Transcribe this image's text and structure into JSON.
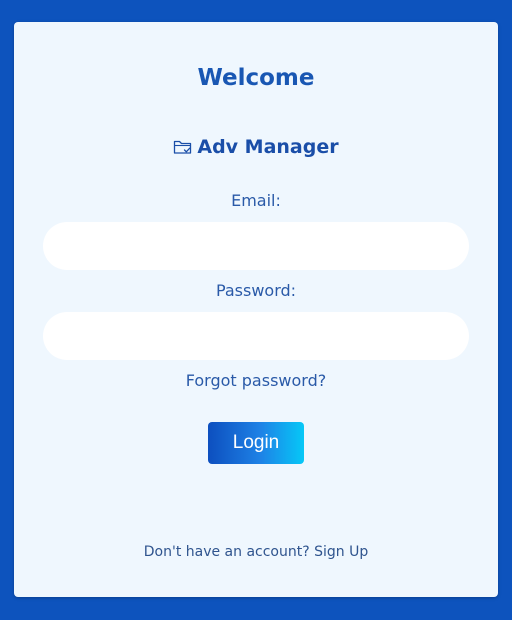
{
  "card": {
    "title": "Welcome",
    "brand": {
      "icon": "folder-check-icon",
      "name": "Adv Manager"
    }
  },
  "form": {
    "email_label": "Email:",
    "email_value": "",
    "password_label": "Password:",
    "password_value": "",
    "forgot_link": "Forgot password?",
    "login_button": "Login"
  },
  "footer": {
    "signup_prompt": "Don't have an account?",
    "signup_link": "Sign Up"
  },
  "colors": {
    "background": "#0d53bd",
    "card": "#eff7fe",
    "accent": "#1957b3",
    "button_gradient_start": "#0d4fbf",
    "button_gradient_end": "#06c8f7"
  }
}
